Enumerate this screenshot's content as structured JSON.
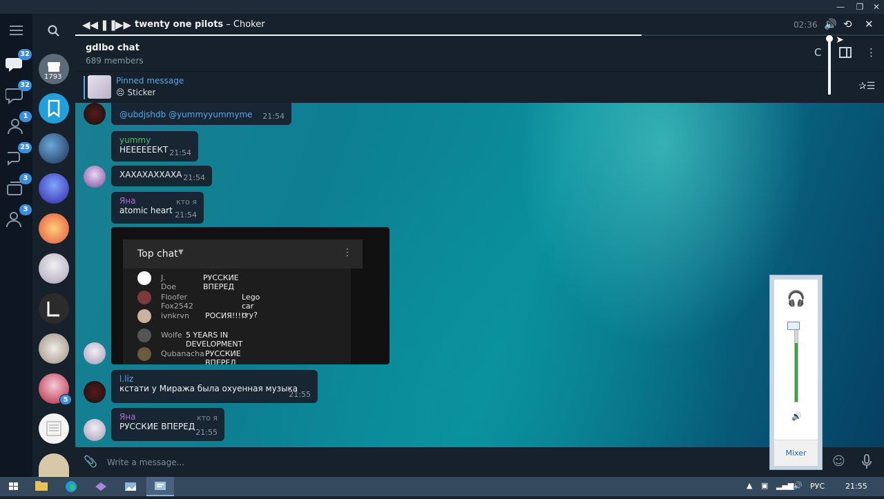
{
  "player": {
    "artist": "twenty one pilots",
    "separator": " – ",
    "title": "Choker",
    "time": "02:36",
    "progress": 0.7
  },
  "chat": {
    "title": "gdlbo chat",
    "members": "689 members"
  },
  "pinned": {
    "label": "Pinned message",
    "text": "😔 Sticker"
  },
  "rail": {
    "badges": [
      "32",
      "32",
      "1",
      "25",
      "3",
      "3"
    ]
  },
  "chatlist": {
    "saved_count": "1793",
    "unread_5": "5"
  },
  "messages": [
    {
      "text": "@ubdjshdb @yummyyummyme",
      "time": "21:54"
    },
    {
      "name": "yummy",
      "text": "НЕЕЕЕЕЕКТ",
      "time": "21:54"
    },
    {
      "text": "ХАХАХАХХАХА",
      "time": "21:54"
    },
    {
      "name": "Яна",
      "role": "кто я",
      "text": "atomic heart",
      "time": "21:54"
    },
    {
      "name": "l.liz",
      "text": "кстати у Миража была охуенная музыка",
      "time": "21:55"
    },
    {
      "name": "Яна",
      "role": "кто я",
      "text": "РУССКИЕ ВПЕРЕД",
      "time": "21:55"
    }
  ],
  "embed": {
    "title": "Top chat",
    "rows": [
      {
        "name": "J. Doe",
        "msg": "РУССКИЕ ВПЕРЕД"
      },
      {
        "name": "Floofer Fox2542",
        "msg": "Lego car cry?"
      },
      {
        "name": "ivnkrvn",
        "msg": "РОСИЯ!!!!!"
      },
      {
        "name": "Wolfe",
        "msg": "5 YEARS IN DEVELOPMENT"
      },
      {
        "name": "Qubanacha",
        "msg": "РУССКИЕ ВПЕРЕД"
      }
    ]
  },
  "input": {
    "placeholder": "Write a message..."
  },
  "mixer": {
    "label": "Mixer",
    "level": 0.82
  },
  "taskbar": {
    "lang": "РУС",
    "clock": "21:55"
  },
  "colors": {
    "accent": "#3a8ee0",
    "bubble": "#182533",
    "name_green": "#4fbf6b",
    "name_purple": "#b06fd6",
    "name_blue": "#5aa7e8"
  }
}
